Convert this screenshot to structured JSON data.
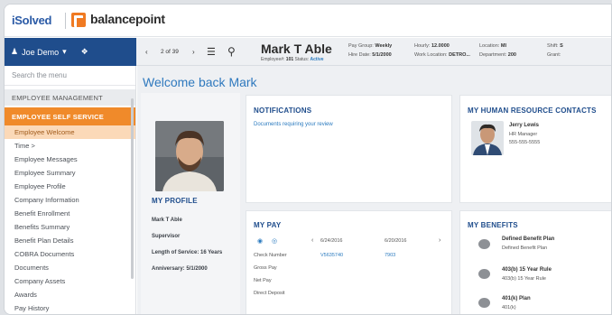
{
  "brand": {
    "isolved": "iSolved",
    "balancepoint": "balancepoint"
  },
  "user": {
    "name": "Joe Demo"
  },
  "toolbar": {
    "pager": "2 of 39",
    "employee_name": "Mark T Able",
    "employee_num_label": "Employee#:",
    "employee_num": "101",
    "status_label": "Status:",
    "status": "Active",
    "paygroup_label": "Pay Group:",
    "paygroup": "Weekly",
    "hiredate_label": "Hire Date:",
    "hiredate": "5/1/2000",
    "hourly_label": "Hourly:",
    "hourly": "12.0000",
    "worklocation_label": "Work Location:",
    "worklocation": "DETRO...",
    "location_label": "Location:",
    "location": "MI",
    "department_label": "Department:",
    "department": "200",
    "shift_label": "Shift:",
    "shift": "S",
    "grant_label": "Grant:",
    "grant": ""
  },
  "sidebar": {
    "search_placeholder": "Search the menu",
    "section_mgmt": "EMPLOYEE MANAGEMENT",
    "section_ess": "EMPLOYEE SELF SERVICE",
    "items": [
      "Employee Welcome",
      "Time >",
      "Employee Messages",
      "Employee Summary",
      "Employee Profile",
      "Company Information",
      "Benefit Enrollment",
      "Benefits Summary",
      "Benefit Plan Details",
      "COBRA Documents",
      "Documents",
      "Company Assets",
      "Awards",
      "Pay History"
    ]
  },
  "main": {
    "welcome": "Welcome back Mark",
    "profile": {
      "title": "MY PROFILE",
      "name": "Mark T Able",
      "role": "Supervisor",
      "service": "Length of Service: 16 Years",
      "anniversary": "Anniversary: 5/1/2000"
    },
    "notifications": {
      "title": "NOTIFICATIONS",
      "text": "Documents requiring your review"
    },
    "hr": {
      "title": "MY HUMAN RESOURCE CONTACTS",
      "name": "Jerry Lewis",
      "role": "HR Manager",
      "phone": "555-555-5555"
    },
    "pay": {
      "title": "MY PAY",
      "dates": [
        "6/24/2016",
        "6/20/2016"
      ],
      "rows": [
        "Check Number",
        "Gross Pay",
        "Net Pay",
        "Direct Deposit"
      ],
      "checks": [
        "V5635740",
        "7903"
      ]
    },
    "benefits": {
      "title": "MY BENEFITS",
      "items": [
        {
          "name": "Defined Benefit Plan",
          "detail": "Defined Benefit Plan"
        },
        {
          "name": "403(b) 15 Year Rule",
          "detail": "403(b) 15 Year Rule"
        },
        {
          "name": "401(k) Plan",
          "detail": "401(k)"
        }
      ]
    }
  },
  "colors": {
    "brand_blue": "#1f4d8c",
    "accent_orange": "#f08a2a",
    "link_blue": "#2a7abf"
  }
}
